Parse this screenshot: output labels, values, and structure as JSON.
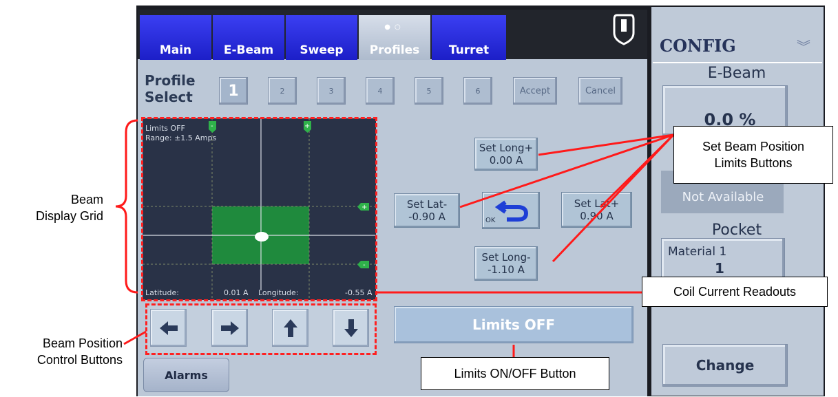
{
  "tabs": [
    {
      "label": "Main"
    },
    {
      "label": "E-Beam"
    },
    {
      "label": "Sweep"
    },
    {
      "label": "Profiles"
    },
    {
      "label": "Turret"
    }
  ],
  "profile": {
    "label_line1": "Profile",
    "label_line2": "Select",
    "buttons": [
      "1",
      "2",
      "3",
      "4",
      "5",
      "6"
    ],
    "selected": "1",
    "accept": "Accept",
    "cancel": "Cancel"
  },
  "grid": {
    "limits_text": "Limits OFF",
    "range_text": "Range: ±1.5 Amps",
    "latitude_label": "Latitude:",
    "latitude_value": "0.01 A",
    "longitude_label": "Longitude:",
    "longitude_value": "-0.55 A"
  },
  "set_buttons": {
    "long_plus": {
      "line1": "Set Long+",
      "line2": "0.00 A"
    },
    "lat_minus": {
      "line1": "Set Lat-",
      "line2": "-0.90 A"
    },
    "lat_plus": {
      "line1": "Set Lat+",
      "line2": "0.90 A"
    },
    "long_minus": {
      "line1": "Set Long-",
      "line2": "-1.10 A"
    },
    "ok": "OK"
  },
  "limits_button": "Limits OFF",
  "alarms_button": "Alarms",
  "right_panel": {
    "config": "CONFIG",
    "ebeam_title": "E-Beam",
    "ebeam_value": "0.0 %",
    "not_available": "Not Available",
    "pocket_title": "Pocket",
    "material": "Material 1",
    "pocket_number": "1",
    "change": "Change"
  },
  "annotations": {
    "beam_display_grid_1": "Beam",
    "beam_display_grid_2": "Display Grid",
    "set_limits_1": "Set Beam Position",
    "set_limits_2": "Limits Buttons",
    "coil_current": "Coil Current Readouts",
    "position_control_1": "Beam Position",
    "position_control_2": "Control Buttons",
    "limits_onoff": "Limits ON/OFF Button"
  },
  "colors": {
    "annotation_red": "#ff1a1a",
    "tab_blue": "#2326d8",
    "grid_green": "#1e8a3c"
  }
}
